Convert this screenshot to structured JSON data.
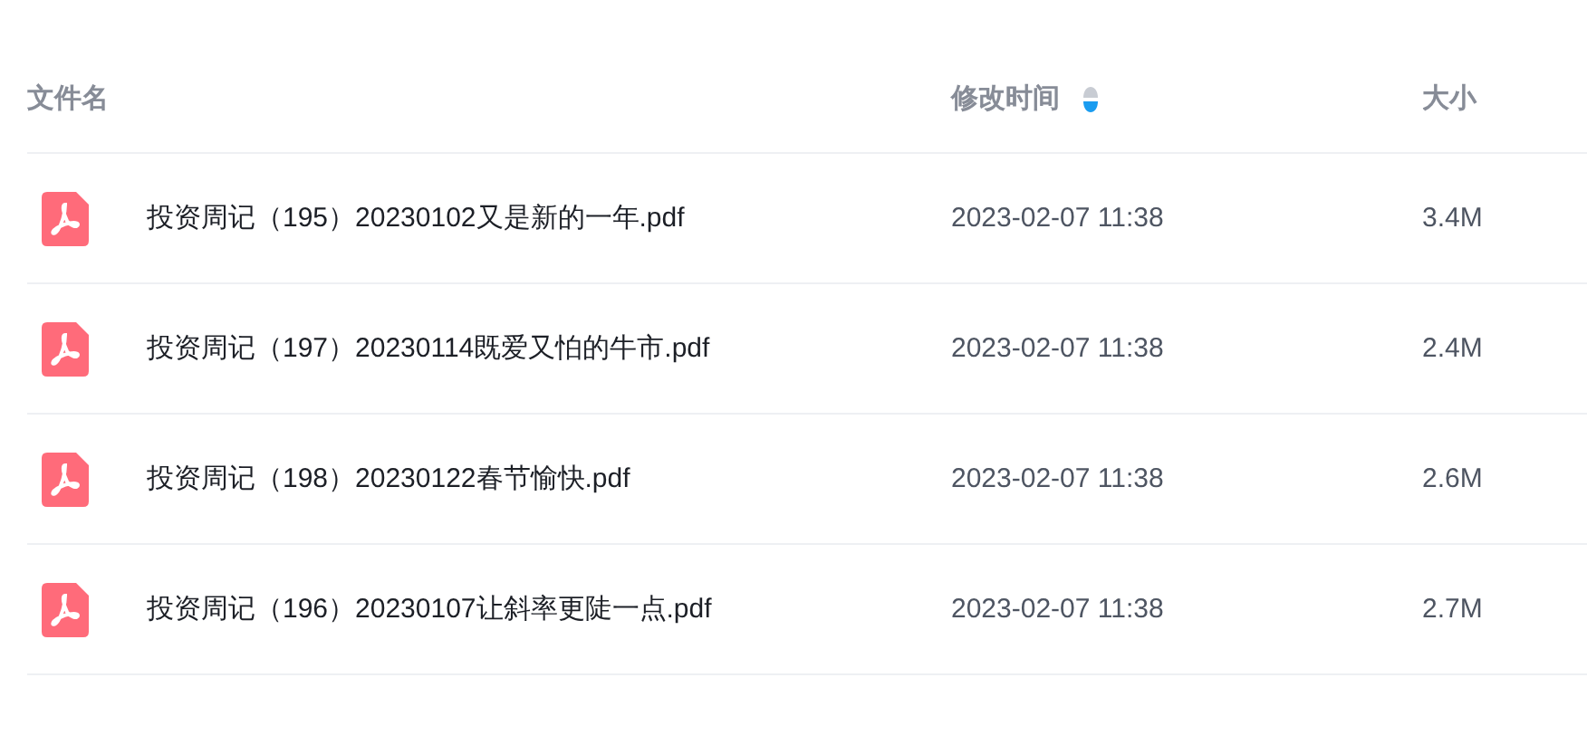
{
  "columns": [
    {
      "label": "文件名"
    },
    {
      "label": "修改时间",
      "sorted": true,
      "descending": true
    },
    {
      "label": "大小"
    }
  ],
  "rows": [
    {
      "kind": "pdf",
      "name": "投资周记（195）20230102又是新的一年.pdf",
      "modified": "2023-02-07 11:38",
      "size": "3.4M"
    },
    {
      "kind": "pdf",
      "name": "投资周记（197）20230114既爱又怕的牛市.pdf",
      "modified": "2023-02-07 11:38",
      "size": "2.4M"
    },
    {
      "kind": "pdf",
      "name": "投资周记（198）20230122春节愉快.pdf",
      "modified": "2023-02-07 11:38",
      "size": "2.6M"
    },
    {
      "kind": "pdf",
      "name": "投资周记（196）20230107让斜率更陡一点.pdf",
      "modified": "2023-02-07 11:38",
      "size": "2.7M"
    }
  ]
}
